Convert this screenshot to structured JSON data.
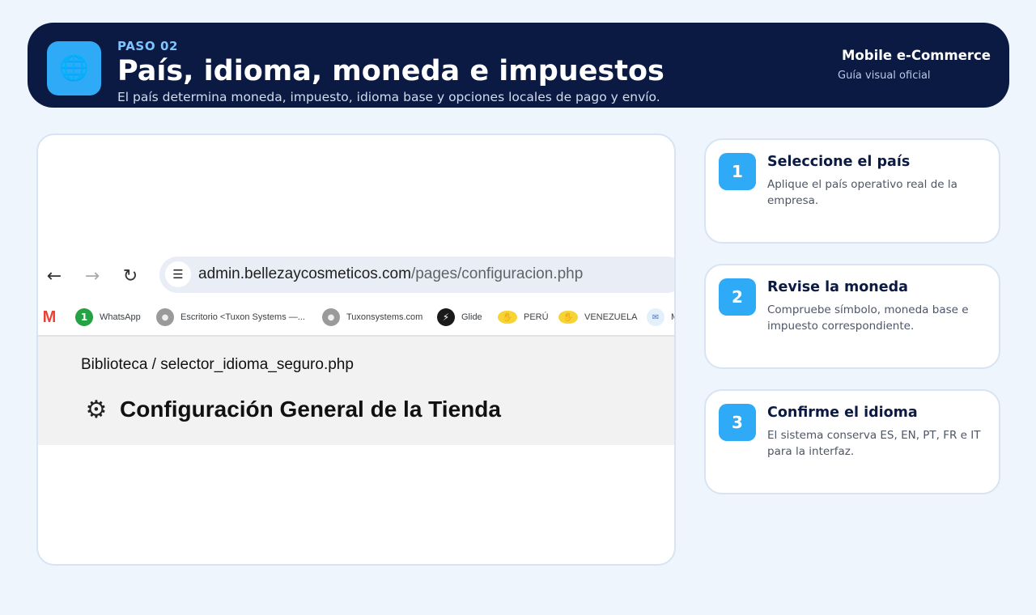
{
  "header": {
    "icon": "globe-icon",
    "step": "PASO 02",
    "title": "País, idioma, moneda e impuestos",
    "subtitle": "El país determina moneda, impuesto, idioma base y opciones locales de pago y envío.",
    "brand": "Mobile e-Commerce",
    "brand_sub": "Guía visual oficial"
  },
  "screenshot": {
    "url_domain": "admin.bellezaycosmeticos.com",
    "url_path": "/pages/configuracion.php",
    "bookmarks": [
      {
        "label": "",
        "icon": "gmail-icon"
      },
      {
        "label": "WhatsApp",
        "icon": "whatsapp-icon",
        "badge": "1"
      },
      {
        "label": "Escritorio <Tuxon Systems —...",
        "icon": "tuxon-icon"
      },
      {
        "label": "Tuxonsystems.com",
        "icon": "tuxon-icon"
      },
      {
        "label": "Glide",
        "icon": "glide-icon"
      },
      {
        "label": "PERÚ",
        "icon": "mercadolibre-icon"
      },
      {
        "label": "VENEZUELA",
        "icon": "mercadolibre-icon"
      },
      {
        "label": "M",
        "icon": "bookmark-icon"
      }
    ],
    "breadcrumb": "Biblioteca / selector_idioma_seguro.php",
    "page_title": "Configuración General de la Tienda"
  },
  "steps": [
    {
      "number": "1",
      "title": "Seleccione el país",
      "desc": "Aplique el país operativo real de la empresa."
    },
    {
      "number": "2",
      "title": "Revise la moneda",
      "desc": "Compruebe símbolo, moneda base e impuesto correspondiente."
    },
    {
      "number": "3",
      "title": "Confirme el idioma",
      "desc": "El sistema conserva ES, EN, PT, FR e IT para la interfaz."
    }
  ],
  "colors": {
    "banner": "#0b1a42",
    "accent": "#2faaf7",
    "background": "#eef5fd"
  }
}
